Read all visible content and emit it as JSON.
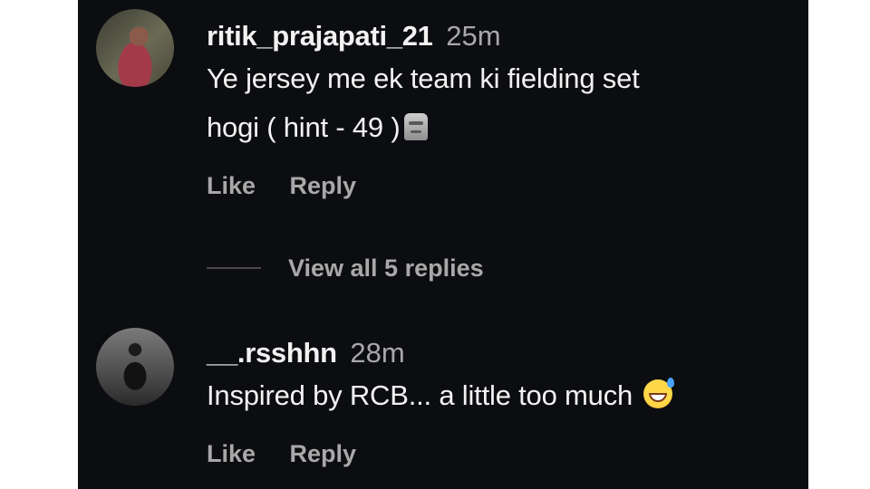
{
  "comments": [
    {
      "username": "ritik_prajapati_21",
      "time": "25m",
      "text_line1": "Ye jersey me ek team ki fielding set",
      "text_line2": "hogi ( hint - 49 )",
      "emoji": "moai-icon",
      "like_label": "Like",
      "reply_label": "Reply"
    },
    {
      "username": "__.rsshhn",
      "time": "28m",
      "text_line1": "Inspired by RCB... a little too much",
      "emoji": "grinning-sweat-icon",
      "like_label": "Like",
      "reply_label": "Reply"
    }
  ],
  "view_replies": {
    "label": "View all 5 replies"
  },
  "colors": {
    "background": "#0c0d10",
    "text": "#f2f2f2",
    "muted": "#a8a8a8"
  }
}
